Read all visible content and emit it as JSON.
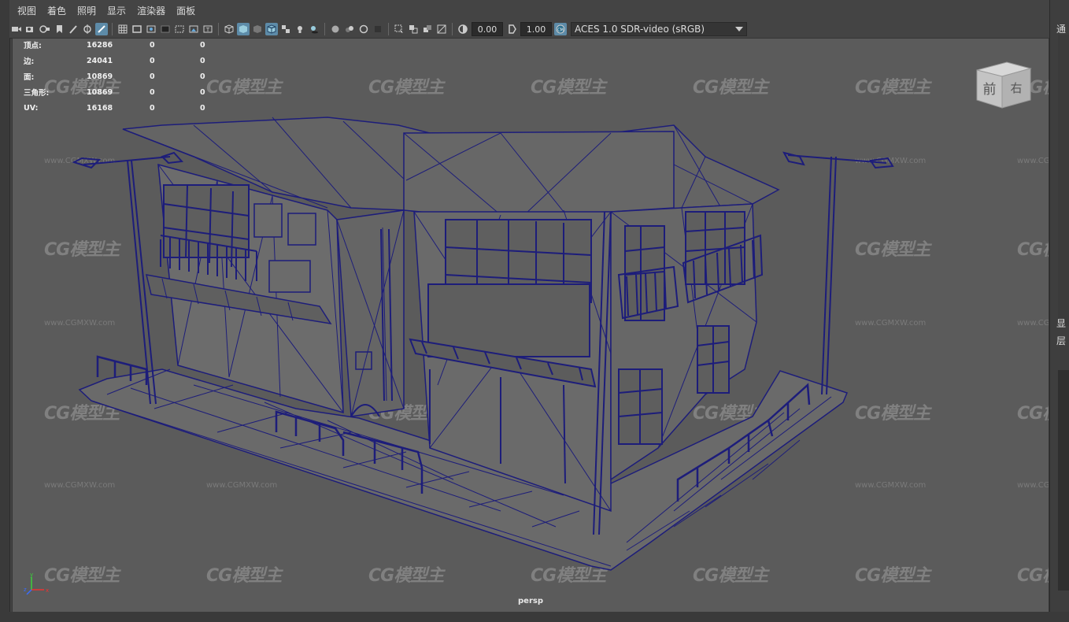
{
  "menu": [
    "视图",
    "着色",
    "照明",
    "显示",
    "渲染器",
    "面板"
  ],
  "toolbar": {
    "exposure": "0.00",
    "gamma": "1.00",
    "color_space": "ACES 1.0 SDR-video (sRGB)"
  },
  "stats": [
    {
      "label": "顶点:",
      "v1": "16286",
      "v2": "0",
      "v3": "0"
    },
    {
      "label": "边:",
      "v1": "24041",
      "v2": "0",
      "v3": "0"
    },
    {
      "label": "面:",
      "v1": "10869",
      "v2": "0",
      "v3": "0"
    },
    {
      "label": "三角形:",
      "v1": "10869",
      "v2": "0",
      "v3": "0"
    },
    {
      "label": "UV:",
      "v1": "16168",
      "v2": "0",
      "v3": "0"
    }
  ],
  "viewcube": {
    "front": "前",
    "right": "右"
  },
  "camera_name": "persp",
  "axis": {
    "y": "y",
    "z": "z",
    "x": "x"
  },
  "watermark": {
    "logo": "CG模型主",
    "url": "www.CGMXW.com"
  },
  "right_panel": {
    "top": "通",
    "mid1": "显",
    "mid2": "层"
  },
  "colors": {
    "wire": "#1d1d7a",
    "viewport_bg": "#5b5b5b",
    "accent": "#5d8ba8"
  }
}
